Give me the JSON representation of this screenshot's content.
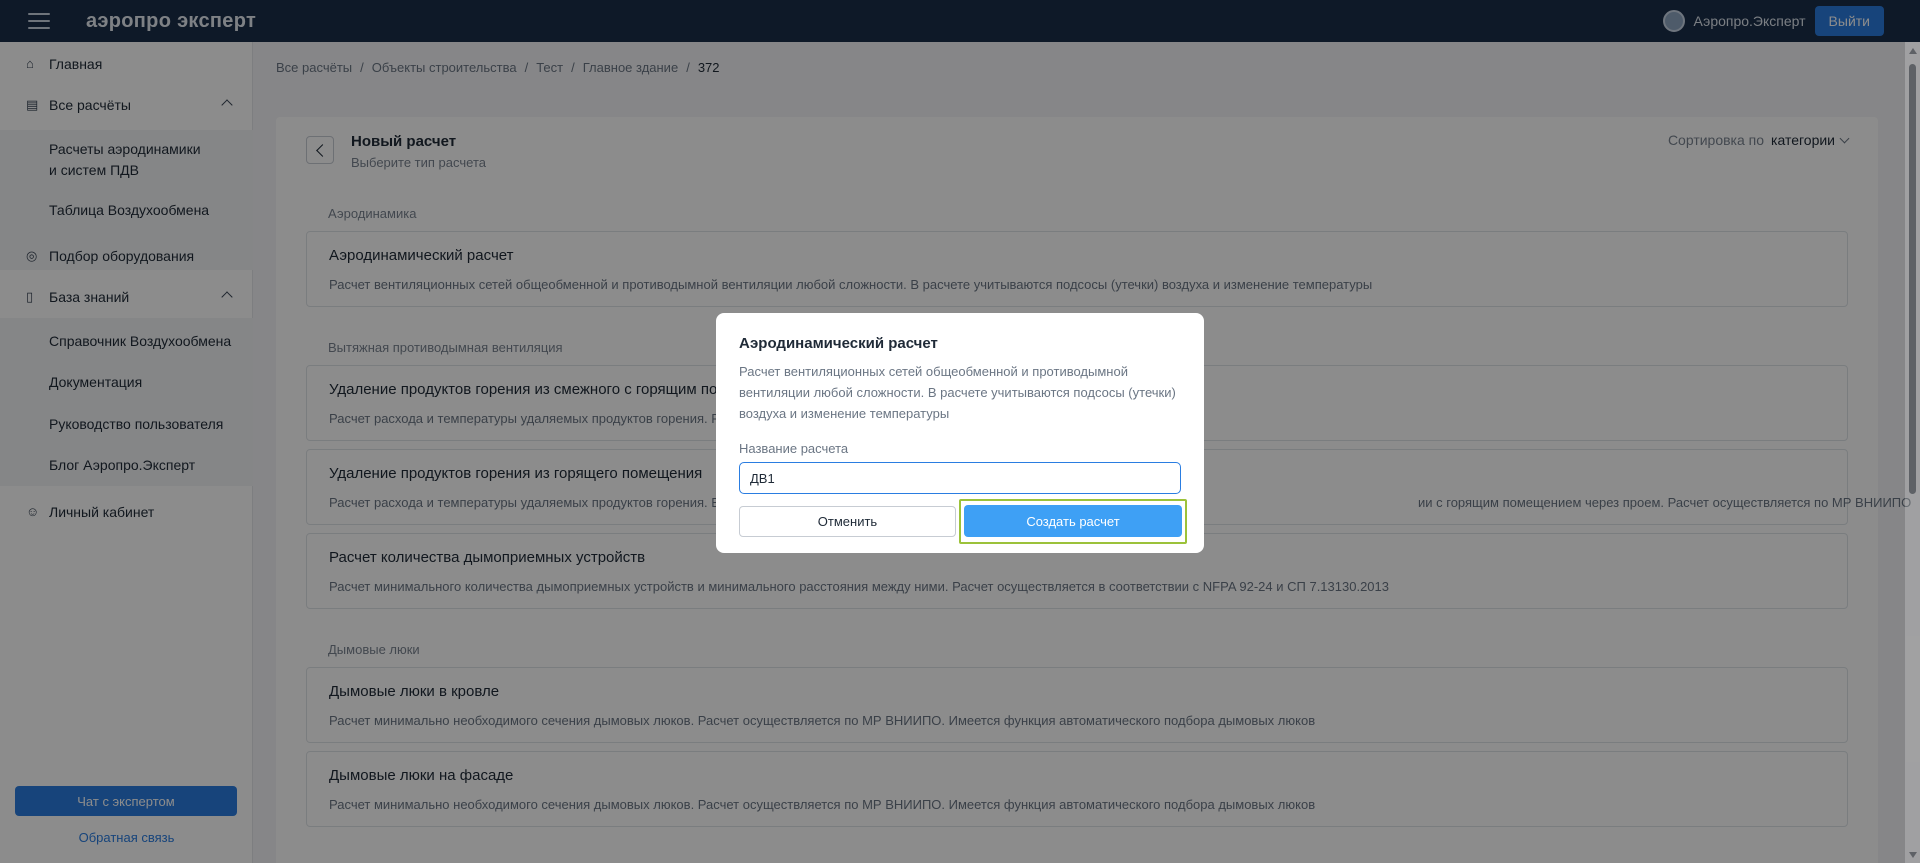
{
  "app": {
    "logo": "аэропро эксперт",
    "user_name": "Аэропро.Эксперт",
    "logout_label": "Выйти"
  },
  "sidebar": {
    "home": "Главная",
    "all_calcs": "Все расчёты",
    "calc_sub_1": "Расчеты аэродинамики",
    "calc_sub_1b": "и систем ПДВ",
    "calc_sub_2": "Таблица Воздухообмена",
    "equipment": "Подбор оборудования",
    "knowledge": "База знаний",
    "kb_sub_1": "Справочник Воздухообмена",
    "kb_sub_2": "Документация",
    "kb_sub_3": "Руководство пользователя",
    "kb_sub_4": "Блог Аэропро.Эксперт",
    "account": "Личный кабинет",
    "chat_button": "Чат с экспертом",
    "feedback": "Обратная связь"
  },
  "breadcrumb": [
    "Все расчёты",
    "Объекты строительства",
    "Тест",
    "Главное здание",
    "372"
  ],
  "header": {
    "title": "Новый расчет",
    "subtitle": "Выберите тип расчета",
    "sort_label": "Сортировка по",
    "sort_value": "категории"
  },
  "sections": {
    "aero": "Аэродинамика",
    "smoke_vent": "Вытяжная противодымная вентиляция",
    "hatches": "Дымовые люки"
  },
  "cards": [
    {
      "title": "Аэродинамический расчет",
      "desc": "Расчет вентиляционных сетей общеобменной и противодымной вентиляции любой сложности. В расчете учитываются подсосы (утечки) воздуха и изменение температуры"
    },
    {
      "title": "Удаление продуктов горения из смежного с горящим по",
      "desc": "Расчет расхода и температуры удаляемых продуктов горения. Р"
    },
    {
      "title": "Удаление продуктов горения из горящего помещения",
      "desc": "Расчет расхода и температуры удаляемых продуктов горения. В",
      "desc_tail": "ии с горящим помещением через проем. Расчет осуществляется по МР ВНИИПО"
    },
    {
      "title": "Расчет количества дымоприемных устройств",
      "desc": "Расчет минимального количества дымоприемных устройств и минимального расстояния между ними. Расчет осуществляется в соответствии с NFPA 92-24 и СП 7.13130.2013"
    },
    {
      "title": "Дымовые люки в кровле",
      "desc": "Расчет минимально необходимого сечения дымовых люков. Расчет осуществляется по МР ВНИИПО. Имеется функция автоматического подбора дымовых люков"
    },
    {
      "title": "Дымовые люки на фасаде",
      "desc": "Расчет минимально необходимого сечения дымовых люков. Расчет осуществляется по МР ВНИИПО. Имеется функция автоматического подбора дымовых люков"
    }
  ],
  "modal": {
    "title": "Аэродинамический расчет",
    "desc": "Расчет вентиляционных сетей общеобменной и противодымной вентиляции любой сложности. В расчете учитываются подсосы (утечки) воздуха и изменение температуры",
    "field_label": "Название расчета",
    "field_value": "ДВ1",
    "cancel_label": "Отменить",
    "create_label": "Создать расчет"
  }
}
